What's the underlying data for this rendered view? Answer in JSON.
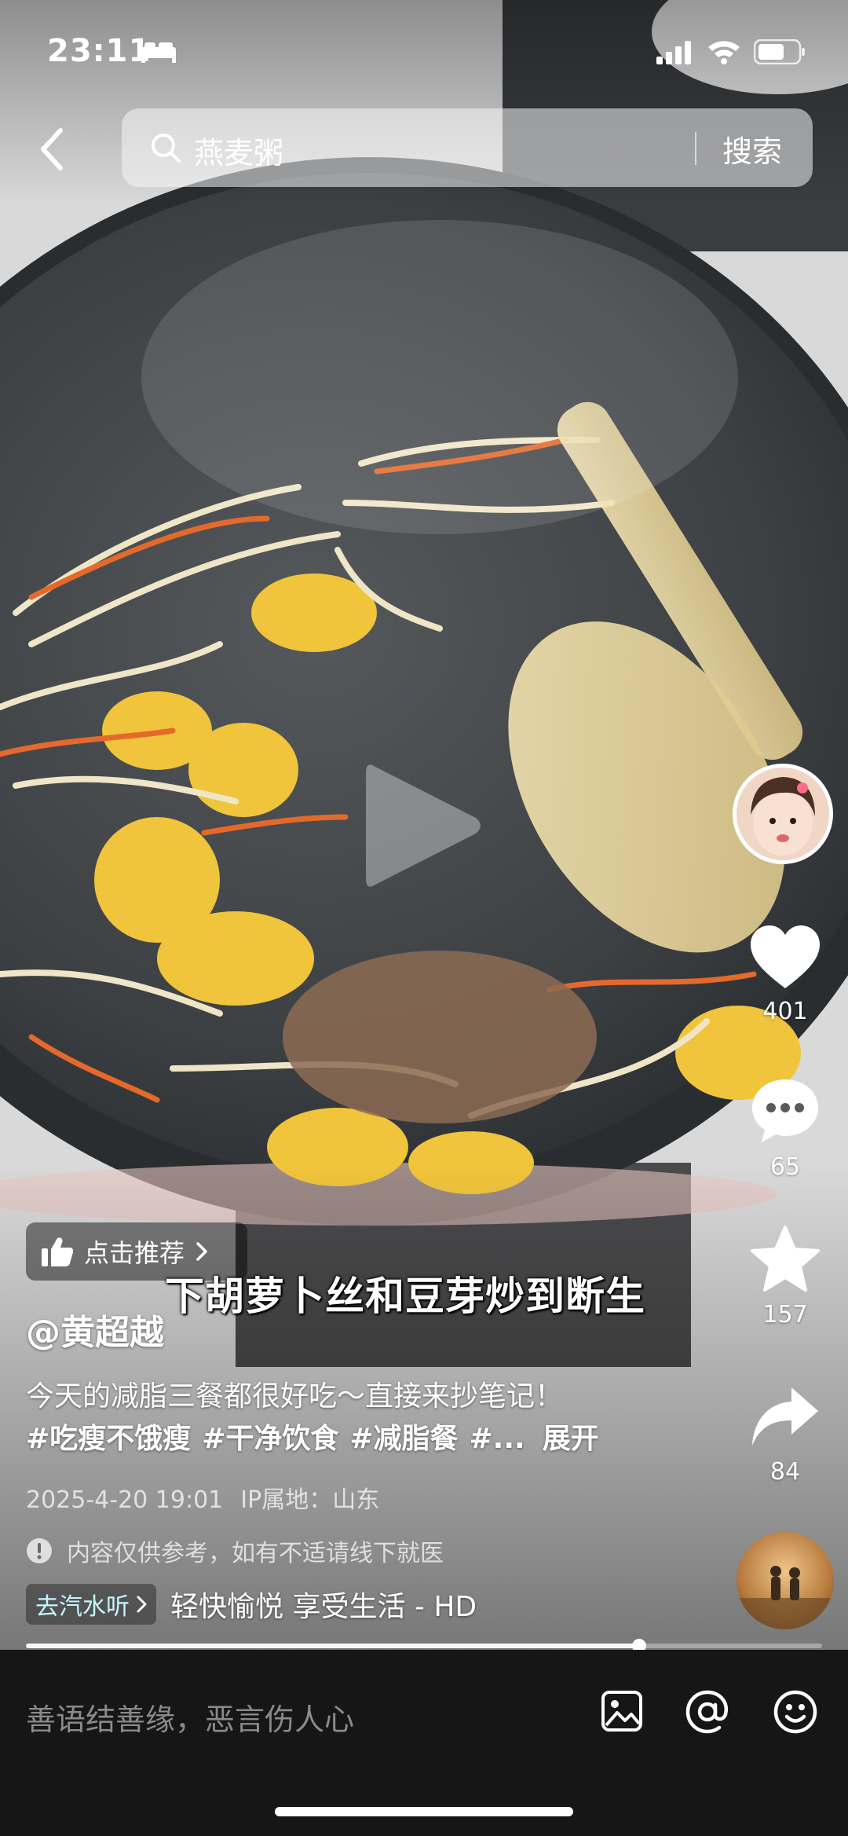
{
  "status_bar": {
    "time": "23:11"
  },
  "search": {
    "query": "燕麦粥",
    "button_label": "搜索"
  },
  "subtitle": "下胡萝卜丝和豆芽炒到断生",
  "recommend_chip": {
    "label": "点击推荐"
  },
  "author": "@黄超越",
  "description": "今天的减脂三餐都很好吃～直接来抄笔记！",
  "hashtags": [
    "#吃瘦不饿瘦",
    "#干净饮食",
    "#减脂餐",
    "#..."
  ],
  "expand_label": "展开",
  "meta": {
    "date": "2025-4-20 19:01",
    "ip": "IP属地：山东"
  },
  "disclaimer": "内容仅供参考，如有不适请线下就医",
  "music": {
    "chip_label": "去汽水听",
    "title": "轻快愉悦 享受生活 - HD"
  },
  "actions": {
    "likes": "401",
    "comments": "65",
    "favorites": "157",
    "shares": "84"
  },
  "progress": {
    "fraction": 0.77
  },
  "comment_bar": {
    "placeholder": "善语结善缘，恶言伤人心"
  },
  "icons": [
    "sleep-icon",
    "signal-icon",
    "wifi-icon",
    "battery-icon",
    "back-icon",
    "search-icon",
    "play-icon",
    "heart-icon",
    "comment-icon",
    "star-icon",
    "share-icon",
    "thumb-up-icon",
    "chevron-right-icon",
    "info-icon",
    "image-icon",
    "at-icon",
    "emoji-icon"
  ]
}
